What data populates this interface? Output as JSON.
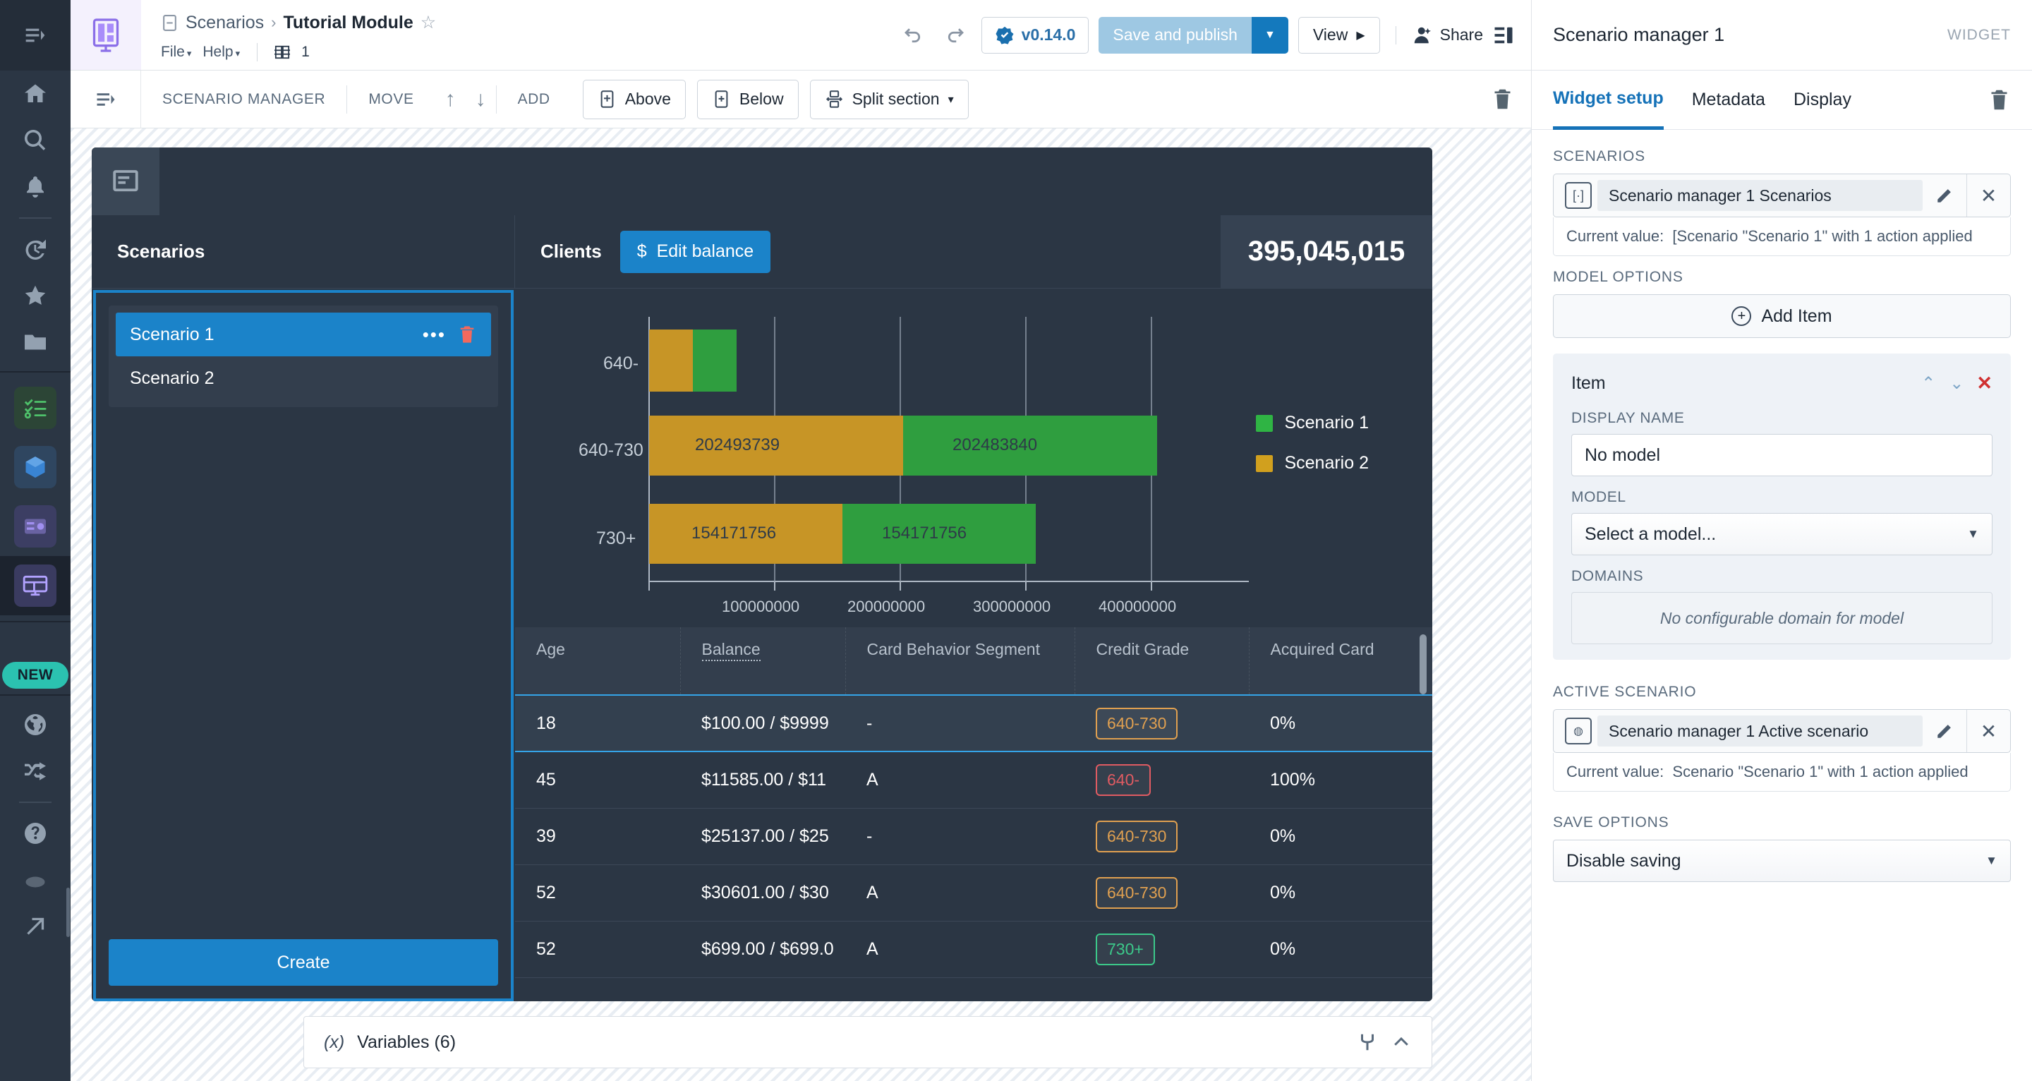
{
  "header": {
    "breadcrumb_parent": "Scenarios",
    "breadcrumb_sep": "›",
    "breadcrumb_current": "Tutorial Module",
    "star": "☆",
    "menu": [
      {
        "label": "File",
        "caret": "▾"
      },
      {
        "label": "Help",
        "caret": "▾"
      }
    ],
    "grid_count": "1",
    "version_label": "v0.14.0",
    "save_publish_label": "Save and publish",
    "save_publish_caret": "▼",
    "view_label": "View",
    "view_caret": "▶",
    "share_label": "Share"
  },
  "toolbar": {
    "section_label": "SCENARIO MANAGER",
    "move_label": "MOVE",
    "move_up": "↑",
    "move_down": "↓",
    "add_label": "ADD",
    "above_label": "Above",
    "below_label": "Below",
    "split_label": "Split section",
    "split_caret": "▾"
  },
  "widget": {
    "scenarios": {
      "title": "Scenarios",
      "items": [
        {
          "name": "Scenario 1",
          "selected": true,
          "dots": "•••"
        },
        {
          "name": "Scenario 2",
          "selected": false,
          "dots": ""
        }
      ],
      "create_label": "Create"
    },
    "clients": {
      "title": "Clients",
      "edit_balance_label": "Edit balance",
      "edit_balance_icon": "$",
      "kpi_value": "395,045,015"
    },
    "table": {
      "columns": [
        "Age",
        "Balance",
        "Card Behavior Segment",
        "Credit Grade",
        "Acquired Card"
      ],
      "rows": [
        {
          "age": "18",
          "balance": "$100.00 / $9999",
          "segment": "-",
          "grade": "640-730",
          "grade_color": "#e0a050",
          "acquired": "0%",
          "selected": true
        },
        {
          "age": "45",
          "balance": "$11585.00 / $11",
          "segment": "A",
          "grade": "640-",
          "grade_color": "#e05b62",
          "acquired": "100%",
          "selected": false
        },
        {
          "age": "39",
          "balance": "$25137.00 / $25",
          "segment": "-",
          "grade": "640-730",
          "grade_color": "#e0a050",
          "acquired": "0%",
          "selected": false
        },
        {
          "age": "52",
          "balance": "$30601.00 / $30",
          "segment": "A",
          "grade": "640-730",
          "grade_color": "#e0a050",
          "acquired": "0%",
          "selected": false
        },
        {
          "age": "52",
          "balance": "$699.00 / $699.0",
          "segment": "A",
          "grade": "730+",
          "grade_color": "#3cc98a",
          "acquired": "0%",
          "selected": false
        }
      ]
    }
  },
  "chart_data": {
    "type": "bar",
    "orientation": "horizontal",
    "stacked": true,
    "title": "",
    "xlabel": "",
    "ylabel": "",
    "categories": [
      "640-",
      "640-730",
      "730+"
    ],
    "series": [
      {
        "name": "Scenario 2",
        "color": "#c79526",
        "values": [
          38389419,
          202493739,
          154171756
        ]
      },
      {
        "name": "Scenario 1",
        "color": "#2f9e3f",
        "values": [
          38389419,
          202483840,
          154171756
        ]
      }
    ],
    "bar_labels": [
      {
        "category": "640-",
        "scenario2": "",
        "scenario1": "",
        "total": "76778838"
      },
      {
        "category": "640-730",
        "scenario2": "202493739",
        "scenario1": "202483840",
        "total": "404977579"
      },
      {
        "category": "730+",
        "scenario2": "154171756",
        "scenario1": "154171756",
        "total": "308343512"
      }
    ],
    "xticks": [
      100000000,
      200000000,
      300000000,
      400000000
    ],
    "xtick_labels": [
      "100000000",
      "200000000",
      "300000000",
      "400000000"
    ],
    "xlim": [
      0,
      470000000
    ],
    "grid": true,
    "legend": [
      "Scenario 1",
      "Scenario 2"
    ],
    "legend_position": "right"
  },
  "variables_bar": {
    "icon": "(x)",
    "label": "Variables (6)",
    "branch_icon": "branch-icon",
    "collapse_icon": "^"
  },
  "right_panel": {
    "title": "Scenario manager 1",
    "kind": "WIDGET",
    "tabs": [
      {
        "label": "Widget setup",
        "active": true
      },
      {
        "label": "Metadata",
        "active": false
      },
      {
        "label": "Display",
        "active": false
      }
    ],
    "scenarios_section": {
      "label": "SCENARIOS",
      "ref_name": "Scenario manager 1 Scenarios",
      "current_value_label": "Current value:",
      "current_value": "[Scenario \"Scenario 1\" with 1 action applied"
    },
    "model_options": {
      "label": "MODEL OPTIONS",
      "add_item_label": "Add Item",
      "item": {
        "title": "Item",
        "display_name_label": "DISPLAY NAME",
        "display_name_value": "No model",
        "model_label": "MODEL",
        "model_value": "Select a model...",
        "domains_label": "DOMAINS",
        "domains_empty": "No configurable domain for model"
      }
    },
    "active_scenario": {
      "label": "ACTIVE SCENARIO",
      "ref_name": "Scenario manager 1 Active scenario",
      "current_value_label": "Current value:",
      "current_value": "Scenario \"Scenario 1\" with 1 action applied"
    },
    "save_options": {
      "label": "SAVE OPTIONS",
      "value": "Disable saving"
    }
  },
  "rail": {
    "new_badge": "NEW"
  }
}
